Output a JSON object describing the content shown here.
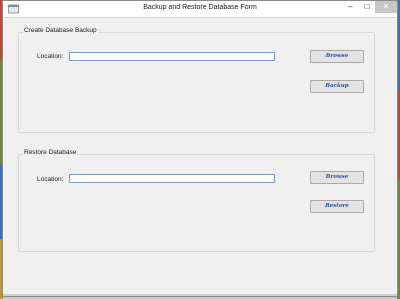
{
  "window": {
    "title": "Backup and Restore Database Form",
    "controls": {
      "minimize": "–",
      "maximize": "□",
      "close": "✕"
    }
  },
  "backup_group": {
    "title": "Create Database Backup",
    "location_label": "Location:",
    "location_value": "",
    "browse_label": "Browse",
    "action_label": "Backup"
  },
  "restore_group": {
    "title": "Restore Database",
    "location_label": "Location:",
    "location_value": "",
    "browse_label": "Browse",
    "action_label": "Restore"
  },
  "icons": [
    "app-icon",
    "minimize-icon",
    "maximize-icon",
    "close-icon"
  ],
  "colors": {
    "button_text": "#2b4fa8",
    "textbox_border": "#7a9cc6",
    "close_button": "#c7c7c7"
  }
}
